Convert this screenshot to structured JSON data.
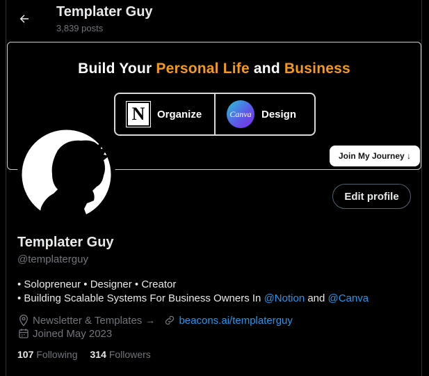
{
  "header": {
    "title": "Templater Guy",
    "posts": "3,839 posts",
    "back_icon": "arrow-left-icon"
  },
  "banner": {
    "headline_prefix": "Build Your ",
    "headline_highlight1": "Personal Life",
    "headline_middle": " and ",
    "headline_highlight2": "Business",
    "left_label": "Organize",
    "left_logo": "N",
    "right_label": "Design",
    "right_logo": "Canva",
    "cta": "Join My Journey ↓",
    "accent": "#f39a1e"
  },
  "profile": {
    "name": "Templater Guy",
    "handle": "@templaterguy",
    "edit_label": "Edit profile",
    "bio_line1": "• Solopreneur • Designer • Creator",
    "bio_line2_prefix": "• Building Scalable Systems For Business Owners In ",
    "mention1": "@Notion",
    "bio_line2_and": " and ",
    "mention2": "@Canva",
    "location": "Newsletter & Templates →",
    "link": "beacons.ai/templaterguy",
    "joined": "Joined May 2023",
    "following_count": "107",
    "following_label": "Following",
    "followers_count": "314",
    "followers_label": "Followers"
  },
  "colors": {
    "background": "#000000",
    "text": "#e7e9ea",
    "muted": "#71767b",
    "link": "#1d9bf0"
  }
}
